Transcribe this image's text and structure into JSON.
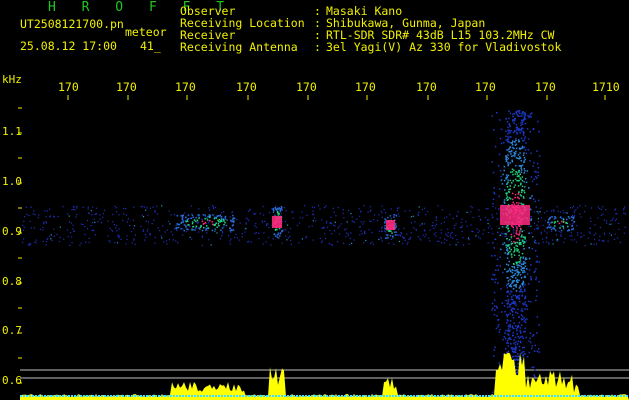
{
  "header": {
    "title": "H R O F F T",
    "file_name": "UT2508121700.pn",
    "mode": "meteor",
    "date_time": "25.08.12 17:00",
    "count": "41_",
    "fields": [
      {
        "label": "Observer",
        "value": "Masaki Kano"
      },
      {
        "label": "Receiving Location",
        "value": "Shibukawa, Gunma, Japan"
      },
      {
        "label": "Receiver",
        "value": "RTL-SDR SDR# 43dB L15 103.2MHz CW"
      },
      {
        "label": "Receiving Antenna",
        "value": "3el Yagi(V) Az 330 for Vladivostok"
      }
    ],
    "colon": ":"
  },
  "axes": {
    "unit": "kHz",
    "x_ticks": [
      "170",
      "170",
      "170",
      "170",
      "170",
      "170",
      "170",
      "170",
      "170",
      "1710"
    ],
    "y_ticks": [
      "1.1",
      "1.0",
      "0.9",
      "0.8",
      "0.7",
      "0.6"
    ]
  },
  "colors": {
    "background": "#000000",
    "label": "#f0f000",
    "title": "#1ec81e",
    "trace": "#ffff00",
    "echo_core": "#ff2a80",
    "echo_mid": "#20d080",
    "noise": "#2030c0"
  }
}
